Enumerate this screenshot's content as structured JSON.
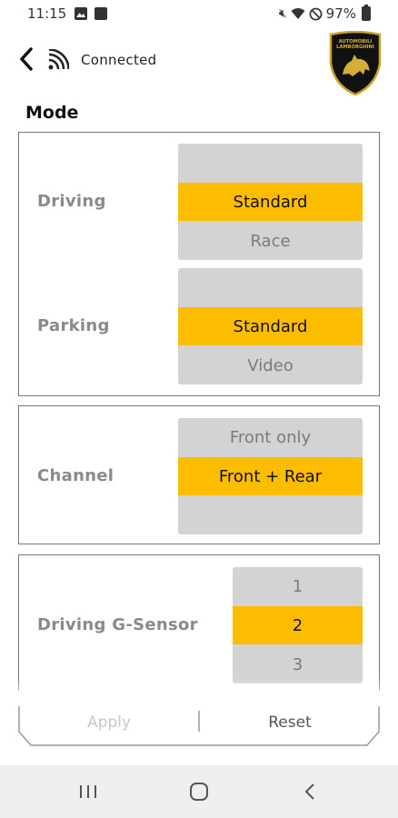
{
  "status_bar": {
    "time": "11:15",
    "battery_pct": "97%"
  },
  "header": {
    "connection_status": "Connected",
    "logo_text": [
      "AUTOMOBILI",
      "LAMBORGHINI"
    ],
    "accent_color": "#fcbd00"
  },
  "mode": {
    "title": "Mode",
    "driving": {
      "label": "Driving",
      "options": [
        "",
        "Standard",
        "Race"
      ],
      "selected": "Standard"
    },
    "parking": {
      "label": "Parking",
      "options": [
        "",
        "Standard",
        "Video"
      ],
      "selected": "Standard"
    }
  },
  "channel": {
    "label": "Channel",
    "options": [
      "Front only",
      "Front + Rear",
      ""
    ],
    "selected": "Front + Rear"
  },
  "gsensor": {
    "label": "Driving G-Sensor",
    "options": [
      "1",
      "2",
      "3"
    ],
    "selected": "2"
  },
  "actions": {
    "apply_label": "Apply",
    "reset_label": "Reset"
  }
}
